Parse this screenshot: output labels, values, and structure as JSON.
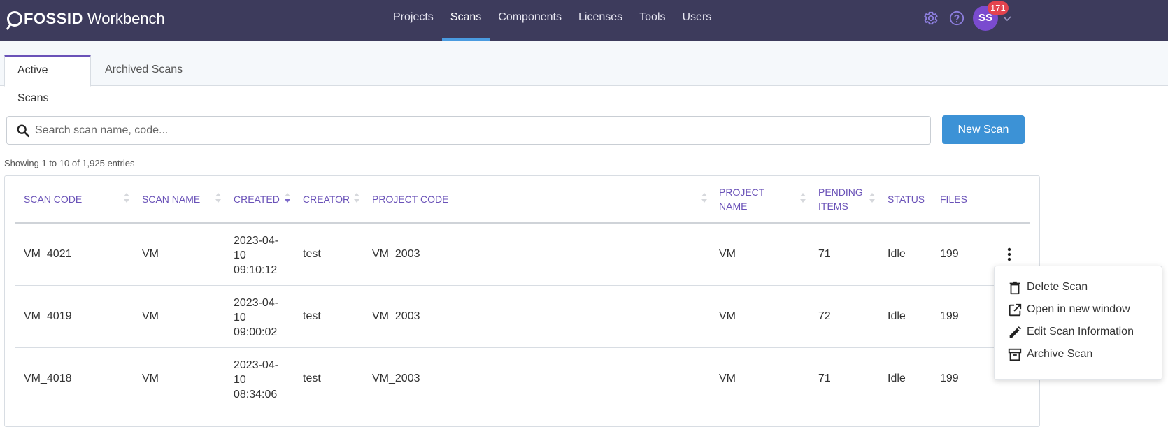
{
  "app": {
    "logo_brand": "FOSSID",
    "logo_product": "Workbench"
  },
  "nav": {
    "items": [
      {
        "label": "Projects"
      },
      {
        "label": "Scans"
      },
      {
        "label": "Components"
      },
      {
        "label": "Licenses"
      },
      {
        "label": "Tools"
      },
      {
        "label": "Users"
      }
    ],
    "active": "Scans"
  },
  "user": {
    "initials": "SS",
    "notification_count": "171"
  },
  "tabs": [
    {
      "label": "Active Scans"
    },
    {
      "label": "Archived Scans"
    }
  ],
  "search": {
    "placeholder": "Search scan name, code...",
    "value": ""
  },
  "new_scan_label": "New Scan",
  "showing_text": "Showing 1 to 10 of 1,925 entries",
  "table": {
    "headers": {
      "scan_code": "SCAN CODE",
      "scan_name": "SCAN NAME",
      "created": "CREATED",
      "creator": "CREATOR",
      "project_code": "PROJECT CODE",
      "project_name_1": "PROJECT",
      "project_name_2": "NAME",
      "pending_1": "PENDING",
      "pending_2": "ITEMS",
      "status": "STATUS",
      "files": "FILES"
    },
    "rows": [
      {
        "scan_code": "VM_4021",
        "scan_name": "VM",
        "created_1": "2023-04-",
        "created_2": "10",
        "created_3": "09:10:12",
        "creator": "test",
        "project_code": "VM_2003",
        "project_name": "VM",
        "pending": "71",
        "status": "Idle",
        "files": "199"
      },
      {
        "scan_code": "VM_4019",
        "scan_name": "VM",
        "created_1": "2023-04-",
        "created_2": "10",
        "created_3": "09:00:02",
        "creator": "test",
        "project_code": "VM_2003",
        "project_name": "VM",
        "pending": "72",
        "status": "Idle",
        "files": "199"
      },
      {
        "scan_code": "VM_4018",
        "scan_name": "VM",
        "created_1": "2023-04-",
        "created_2": "10",
        "created_3": "08:34:06",
        "creator": "test",
        "project_code": "VM_2003",
        "project_name": "VM",
        "pending": "71",
        "status": "Idle",
        "files": "199"
      }
    ]
  },
  "context_menu": {
    "items": [
      {
        "label": "Delete Scan",
        "icon": "trash-icon"
      },
      {
        "label": "Open in new window",
        "icon": "open-in-new-icon"
      },
      {
        "label": "Edit Scan Information",
        "icon": "pencil-icon"
      },
      {
        "label": "Archive Scan",
        "icon": "archive-icon"
      }
    ]
  }
}
